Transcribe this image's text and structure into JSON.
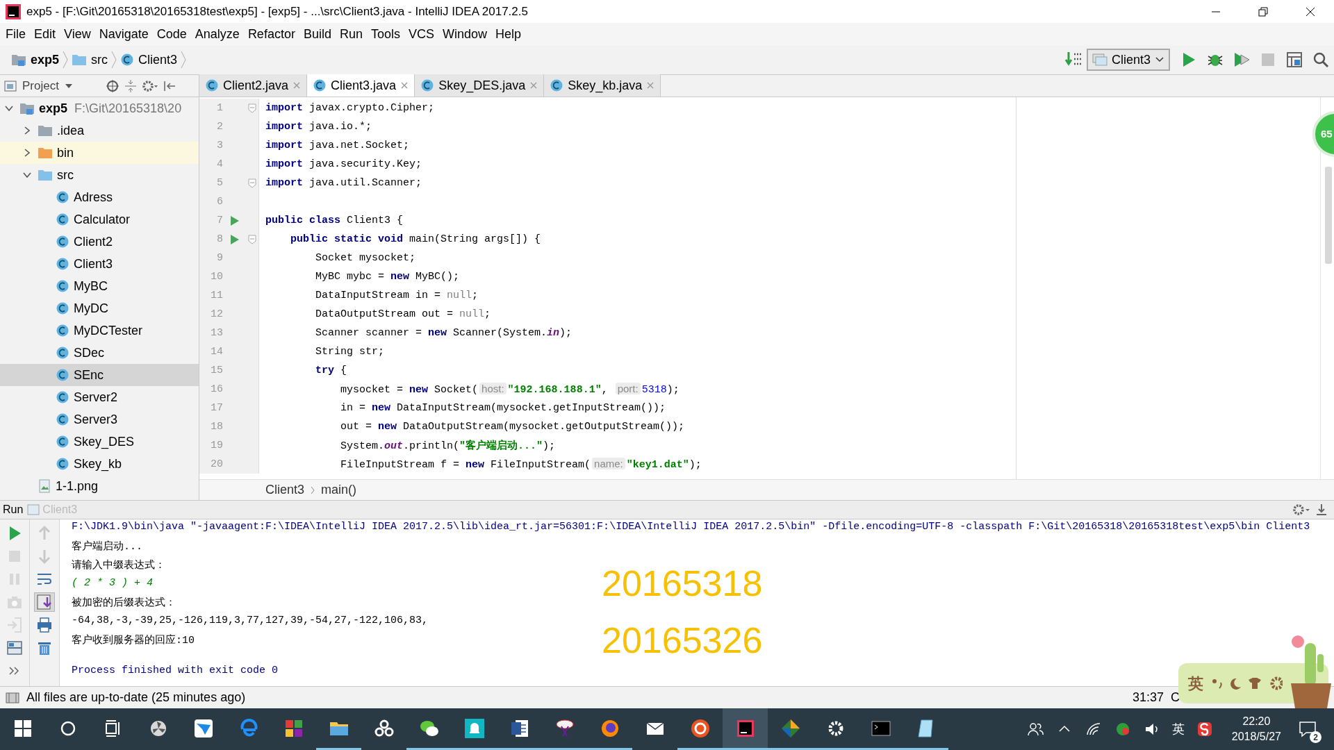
{
  "window": {
    "title": "exp5 - [F:\\Git\\20165318\\20165318test\\exp5] - [exp5] - ...\\src\\Client3.java - IntelliJ IDEA 2017.2.5"
  },
  "menu": [
    "File",
    "Edit",
    "View",
    "Navigate",
    "Code",
    "Analyze",
    "Refactor",
    "Build",
    "Run",
    "Tools",
    "VCS",
    "Window",
    "Help"
  ],
  "breadcrumb": [
    {
      "kind": "project",
      "label": "exp5"
    },
    {
      "kind": "folder",
      "label": "src"
    },
    {
      "kind": "class",
      "label": "Client3"
    }
  ],
  "run_config": "Client3",
  "project_panel": {
    "title": "Project"
  },
  "tree": [
    {
      "kind": "project",
      "label": "exp5",
      "path": "F:\\Git\\20165318\\20",
      "expanded": true,
      "selected": false,
      "children": [
        {
          "kind": "config-folder",
          "label": ".idea",
          "expanded": false,
          "selected": false
        },
        {
          "kind": "excluded-folder",
          "label": "bin",
          "expanded": false,
          "selected": false
        },
        {
          "kind": "source-folder",
          "label": "src",
          "expanded": true,
          "selected": false,
          "children": [
            {
              "kind": "class",
              "label": "Adress",
              "selected": false
            },
            {
              "kind": "class",
              "label": "Calculator",
              "selected": false
            },
            {
              "kind": "class",
              "label": "Client2",
              "selected": false
            },
            {
              "kind": "class",
              "label": "Client3",
              "selected": false
            },
            {
              "kind": "class",
              "label": "MyBC",
              "selected": false
            },
            {
              "kind": "class",
              "label": "MyDC",
              "selected": false
            },
            {
              "kind": "class",
              "label": "MyDCTester",
              "selected": false
            },
            {
              "kind": "class",
              "label": "SDec",
              "selected": false
            },
            {
              "kind": "class",
              "label": "SEnc",
              "selected": true
            },
            {
              "kind": "class",
              "label": "Server2",
              "selected": false
            },
            {
              "kind": "class",
              "label": "Server3",
              "selected": false
            },
            {
              "kind": "class",
              "label": "Skey_DES",
              "selected": false
            },
            {
              "kind": "class",
              "label": "Skey_kb",
              "selected": false
            }
          ]
        },
        {
          "kind": "image",
          "label": "1-1.png",
          "selected": false
        }
      ]
    }
  ],
  "editor_tabs": [
    {
      "label": "Client2.java",
      "selected": false
    },
    {
      "label": "Client3.java",
      "selected": true
    },
    {
      "label": "Skey_DES.java",
      "selected": false
    },
    {
      "label": "Skey_kb.java",
      "selected": false
    }
  ],
  "code": [
    {
      "number": "1",
      "fold": true,
      "run": false,
      "tokens": [
        {
          "kind": "keyword",
          "text": "import"
        },
        {
          "kind": "plain",
          "text": " javax.crypto.Cipher;"
        }
      ]
    },
    {
      "number": "2",
      "fold": false,
      "run": false,
      "tokens": [
        {
          "kind": "keyword",
          "text": "import"
        },
        {
          "kind": "plain",
          "text": " java.io.*;"
        }
      ]
    },
    {
      "number": "3",
      "fold": false,
      "run": false,
      "tokens": [
        {
          "kind": "keyword",
          "text": "import"
        },
        {
          "kind": "plain",
          "text": " java.net.Socket;"
        }
      ]
    },
    {
      "number": "4",
      "fold": false,
      "run": false,
      "tokens": [
        {
          "kind": "keyword",
          "text": "import"
        },
        {
          "kind": "plain",
          "text": " java.security.Key;"
        }
      ]
    },
    {
      "number": "5",
      "fold": true,
      "run": false,
      "tokens": [
        {
          "kind": "keyword",
          "text": "import"
        },
        {
          "kind": "plain",
          "text": " java.util.Scanner;"
        }
      ]
    },
    {
      "number": "6",
      "fold": false,
      "run": false
    },
    {
      "number": "7",
      "fold": false,
      "run": true,
      "tokens": [
        {
          "kind": "keyword",
          "text": "public class"
        },
        {
          "kind": "plain",
          "text": " Client3 {"
        }
      ]
    },
    {
      "number": "8",
      "fold": true,
      "run": true,
      "tokens": [
        {
          "kind": "keyword",
          "text": "    public static void"
        },
        {
          "kind": "plain",
          "text": " main(String args[]) {"
        }
      ]
    },
    {
      "number": "9",
      "fold": false,
      "run": false,
      "tokens": [
        {
          "kind": "plain",
          "text": "        Socket mysocket;"
        }
      ]
    },
    {
      "number": "10",
      "fold": false,
      "run": false,
      "tokens": [
        {
          "kind": "plain",
          "text": "        MyBC mybc = "
        },
        {
          "kind": "keyword",
          "text": "new"
        },
        {
          "kind": "plain",
          "text": " MyBC();"
        }
      ]
    },
    {
      "number": "11",
      "fold": false,
      "run": false,
      "tokens": [
        {
          "kind": "plain",
          "text": "        DataInputStream in = "
        },
        {
          "kind": "muted",
          "text": "null"
        },
        {
          "kind": "plain",
          "text": ";"
        }
      ]
    },
    {
      "number": "12",
      "fold": false,
      "run": false,
      "tokens": [
        {
          "kind": "plain",
          "text": "        DataOutputStream out = "
        },
        {
          "kind": "muted",
          "text": "null"
        },
        {
          "kind": "plain",
          "text": ";"
        }
      ]
    },
    {
      "number": "13",
      "fold": false,
      "run": false,
      "tokens": [
        {
          "kind": "plain",
          "text": "        Scanner scanner = "
        },
        {
          "kind": "keyword",
          "text": "new"
        },
        {
          "kind": "plain",
          "text": " Scanner(System."
        },
        {
          "kind": "static",
          "text": "in"
        },
        {
          "kind": "plain",
          "text": ");"
        }
      ]
    },
    {
      "number": "14",
      "fold": false,
      "run": false,
      "tokens": [
        {
          "kind": "plain",
          "text": "        String str;"
        }
      ]
    },
    {
      "number": "15",
      "fold": false,
      "run": false,
      "tokens": [
        {
          "kind": "keyword",
          "text": "        try"
        },
        {
          "kind": "plain",
          "text": " {"
        }
      ]
    },
    {
      "number": "16",
      "fold": false,
      "run": false,
      "tokens": [
        {
          "kind": "plain",
          "text": "            mysocket = "
        },
        {
          "kind": "keyword",
          "text": "new"
        },
        {
          "kind": "plain",
          "text": " Socket("
        },
        {
          "kind": "hint",
          "text": "host:"
        },
        {
          "kind": "string",
          "text": "\"192.168.188.1\""
        },
        {
          "kind": "plain",
          "text": ", "
        },
        {
          "kind": "hint",
          "text": "port:"
        },
        {
          "kind": "number",
          "text": "5318"
        },
        {
          "kind": "plain",
          "text": ");"
        }
      ]
    },
    {
      "number": "17",
      "fold": false,
      "run": false,
      "tokens": [
        {
          "kind": "plain",
          "text": "            in = "
        },
        {
          "kind": "keyword",
          "text": "new"
        },
        {
          "kind": "plain",
          "text": " DataInputStream(mysocket.getInputStream());"
        }
      ]
    },
    {
      "number": "18",
      "fold": false,
      "run": false,
      "tokens": [
        {
          "kind": "plain",
          "text": "            out = "
        },
        {
          "kind": "keyword",
          "text": "new"
        },
        {
          "kind": "plain",
          "text": " DataOutputStream(mysocket.getOutputStream());"
        }
      ]
    },
    {
      "number": "19",
      "fold": false,
      "run": false,
      "tokens": [
        {
          "kind": "plain",
          "text": "            System."
        },
        {
          "kind": "static",
          "text": "out"
        },
        {
          "kind": "plain",
          "text": ".println("
        },
        {
          "kind": "string",
          "text": "\"客户端启动...\""
        },
        {
          "kind": "plain",
          "text": ");"
        }
      ]
    },
    {
      "number": "20",
      "fold": false,
      "run": false,
      "tokens": [
        {
          "kind": "plain",
          "text": "            FileInputStream f = "
        },
        {
          "kind": "keyword",
          "text": "new"
        },
        {
          "kind": "plain",
          "text": " FileInputStream("
        },
        {
          "kind": "hint",
          "text": "name:"
        },
        {
          "kind": "string",
          "text": "\"key1.dat\""
        },
        {
          "kind": "plain",
          "text": ");"
        }
      ]
    }
  ],
  "editor_breadcrumb": [
    "Client3",
    "main()"
  ],
  "floating_badge": "65",
  "run_panel": {
    "title": "Run",
    "tab": "Client3"
  },
  "run_tools": [
    {
      "kind": "rerun",
      "disabled": false
    },
    {
      "kind": "stop",
      "disabled": true
    },
    {
      "kind": "pause",
      "disabled": true
    },
    {
      "kind": "camera",
      "disabled": true
    },
    {
      "kind": "exit",
      "disabled": true
    },
    {
      "kind": "layout",
      "disabled": false
    },
    {
      "kind": "more",
      "disabled": false
    }
  ],
  "console_tools": [
    {
      "kind": "up",
      "disabled": true,
      "on": false
    },
    {
      "kind": "down",
      "disabled": true,
      "on": false
    },
    {
      "kind": "wrap",
      "disabled": false,
      "on": false
    },
    {
      "kind": "scroll-end",
      "disabled": false,
      "on": true
    },
    {
      "kind": "print",
      "disabled": false,
      "on": false
    },
    {
      "kind": "clear",
      "disabled": false,
      "on": false
    }
  ],
  "console": [
    {
      "kind": "command",
      "text": "F:\\JDK1.9\\bin\\java \"-javaagent:F:\\IDEA\\IntelliJ IDEA 2017.2.5\\lib\\idea_rt.jar=56301:F:\\IDEA\\IntelliJ IDEA 2017.2.5\\bin\" -Dfile.encoding=UTF-8 -classpath F:\\Git\\20165318\\20165318test\\exp5\\bin Client3"
    },
    {
      "kind": "output",
      "text": "客户端启动..."
    },
    {
      "kind": "output",
      "text": "请输入中缀表达式："
    },
    {
      "kind": "input",
      "text": "( 2 * 3 ) + 4"
    },
    {
      "kind": "output",
      "text": "被加密的后缀表达式："
    },
    {
      "kind": "output",
      "text": "-64,38,-3,-39,25,-126,119,3,77,127,39,-54,27,-122,106,83,"
    },
    {
      "kind": "output",
      "text": "客户收到服务器的回应:10"
    },
    {
      "kind": "exit",
      "text": "Process finished with exit code 0"
    }
  ],
  "overlay_texts": [
    "20165318",
    "20165326"
  ],
  "status_bar": {
    "message": "All files are up-to-date (25 minutes ago)",
    "position": "31:37",
    "separator": "C"
  },
  "ime_widget": {
    "mode": "英"
  },
  "taskbar": {
    "apps": [
      {
        "kind": "fan",
        "running": false,
        "selected": false
      },
      {
        "kind": "bird",
        "running": false,
        "selected": false
      },
      {
        "kind": "edge",
        "running": false,
        "selected": false
      },
      {
        "kind": "tiles",
        "running": false,
        "selected": false
      },
      {
        "kind": "folder",
        "running": true,
        "selected": false
      },
      {
        "kind": "rings",
        "running": false,
        "selected": false
      },
      {
        "kind": "chat",
        "running": true,
        "selected": false
      },
      {
        "kind": "bell",
        "running": true,
        "selected": false
      },
      {
        "kind": "word",
        "running": true,
        "selected": false
      },
      {
        "kind": "scissors",
        "running": true,
        "selected": false
      },
      {
        "kind": "firefox",
        "running": true,
        "selected": false
      },
      {
        "kind": "mail",
        "running": false,
        "selected": false
      },
      {
        "kind": "ubuntu",
        "running": true,
        "selected": false
      },
      {
        "kind": "intellij",
        "running": true,
        "selected": true
      },
      {
        "kind": "git",
        "running": true,
        "selected": false
      },
      {
        "kind": "gear",
        "running": true,
        "selected": false
      },
      {
        "kind": "terminal",
        "running": true,
        "selected": false
      },
      {
        "kind": "notepad",
        "running": true,
        "selected": false
      }
    ],
    "ime": "英",
    "time": "22:20",
    "date": "2018/5/27",
    "notifications": "2"
  }
}
